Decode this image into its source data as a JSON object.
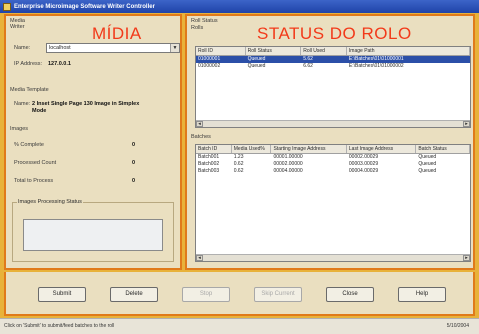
{
  "window": {
    "title": "Enterprise Microimage Software Writer Controller"
  },
  "midia_panel": {
    "overlay_label": "MÍDIA",
    "section_writer": "Media Writer",
    "name_label": "Name:",
    "name_value": "localhost",
    "ip_label": "IP Address:",
    "ip_value": "127.0.0.1",
    "template_section": "Media Template",
    "template_name_label": "Name:",
    "template_name_value": "2 Inset Single Page 130 Image in Simplex Mode",
    "images_section": "Images",
    "pct_complete_label": "% Complete",
    "pct_complete_value": "0",
    "processed_label": "Processed Count",
    "processed_value": "0",
    "total_label": "Total to Process",
    "total_value": "0",
    "processing_status_label": "Images Processing Status"
  },
  "status_panel": {
    "overlay_label": "STATUS DO ROLO",
    "roll_status_title": "Roll Status",
    "rolls_label": "Rolls",
    "rolls_columns": [
      "Roll ID",
      "Roll Status",
      "Roll Used",
      "Image Path"
    ],
    "rolls_rows": [
      [
        "01000001",
        "Queued",
        "5.62",
        "E:\\Batches\\01\\01000001"
      ],
      [
        "01000002",
        "Queued",
        "6.62",
        "E:\\Batches\\01\\01000002"
      ]
    ],
    "batches_label": "Batches",
    "batches_columns": [
      "Batch ID",
      "Media Used%",
      "Starting Image Address",
      "Last Image Address",
      "Batch Status"
    ],
    "batches_rows": [
      [
        "Batch001",
        "1.23",
        "00001.00000",
        "00002.00029",
        "Queued"
      ],
      [
        "Batch002",
        "0.62",
        "00002.00000",
        "00003.00029",
        "Queued"
      ],
      [
        "Batch003",
        "0.62",
        "00004.00000",
        "00004.00029",
        "Queued"
      ]
    ]
  },
  "buttons": {
    "submit": "Submit",
    "delete": "Delete",
    "stop": "Stop",
    "skip": "Skip Current",
    "close": "Close",
    "help": "Help"
  },
  "statusbar": {
    "message": "Click on 'Submit' to submit/feed batches to the roll",
    "date": "5/10/2004"
  }
}
